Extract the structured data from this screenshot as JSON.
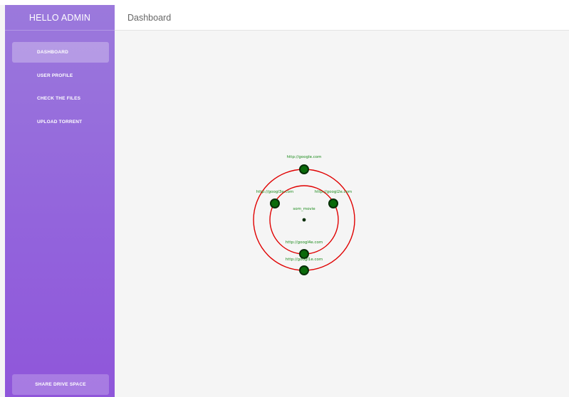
{
  "sidebar": {
    "header": "HELLO ADMIN",
    "items": [
      {
        "label": "DASHBOARD",
        "active": true
      },
      {
        "label": "USER PROFILE",
        "active": false
      },
      {
        "label": "CHECK THE FILES",
        "active": false
      },
      {
        "label": "UPLOAD TORRENT",
        "active": false
      }
    ],
    "footer_button": "SHARE DRIVE SPACE"
  },
  "header": {
    "title": "Dashboard"
  },
  "graph": {
    "center_label": "som_movie",
    "nodes": [
      {
        "label": "http://google.com"
      },
      {
        "label": "http://googl3e.com"
      },
      {
        "label": "http://googl2e.com"
      },
      {
        "label": "http://googl4e.com"
      },
      {
        "label": "http://googl1e.com"
      }
    ],
    "colors": {
      "ring": "#e00000",
      "node_fill": "#0a6a0a",
      "node_stroke": "#062e06",
      "label": "#1a8a1a"
    }
  }
}
